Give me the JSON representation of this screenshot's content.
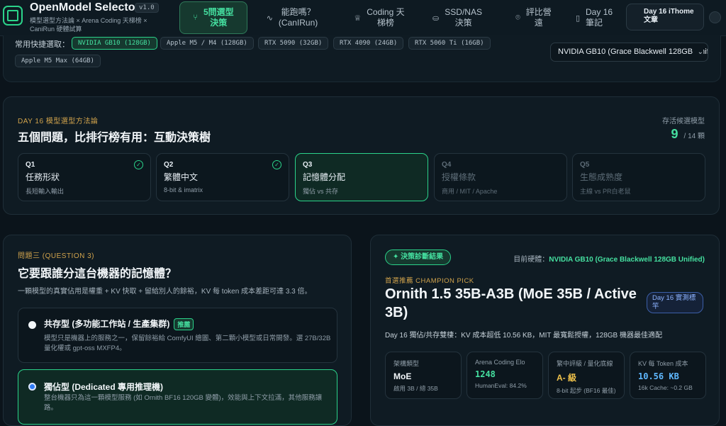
{
  "app": {
    "title": "OpenModel Selector",
    "version": "v1.0",
    "subtitle": "模型選型方法論 × Arena Coding 天梯榜 × CaniRun 硬體試算"
  },
  "nav": [
    {
      "label": "5問選型\n決策",
      "icon": "branch-icon",
      "active": true
    },
    {
      "label": "能跑嗎？\n(CanIRun)",
      "icon": "pulse-icon",
      "active": false
    },
    {
      "label": "Coding 天\n梯榜",
      "icon": "trophy-icon",
      "active": false
    },
    {
      "label": "SSD/NAS\n決策",
      "icon": "drive-icon",
      "active": false
    },
    {
      "label": "評比營\n遠",
      "icon": "satellite-icon",
      "active": false
    },
    {
      "label": "Day 16\n筆記",
      "icon": "book-icon",
      "active": false
    }
  ],
  "ithome": {
    "label": "Day 16 iThome\n文章"
  },
  "hardware": {
    "quick_label": "常用快捷選取：",
    "presets": [
      "NVIDIA GB10 (128GB)",
      "Apple M5 / M4 (128GB)",
      "RTX 5090 (32GB)",
      "RTX 4090 (24GB)",
      "RTX 5060 Ti (16GB)",
      "Apple M5 Max (64GB)"
    ],
    "selected_preset": "NVIDIA GB10 (128GB)",
    "select_value": "NVIDIA GB10 (Grace Blackwell 128GB Unif"
  },
  "tree": {
    "eyebrow": "DAY 16 模型選型方法論",
    "title": "五個問題，比排行榜有用：互動決策樹",
    "remaining_label": "存活候選模型",
    "remaining": "9",
    "total": "/ 14 顆",
    "questions": [
      {
        "num": "Q1",
        "title": "任務形狀",
        "sub": "長短輸入輸出",
        "state": "done"
      },
      {
        "num": "Q2",
        "title": "繁體中文",
        "sub": "8-bit & imatrix",
        "state": "done"
      },
      {
        "num": "Q3",
        "title": "記憶體分配",
        "sub": "獨佔 vs 共存",
        "state": "active"
      },
      {
        "num": "Q4",
        "title": "授權條款",
        "sub": "商用 / MIT / Apache",
        "state": "pending"
      },
      {
        "num": "Q5",
        "title": "生態成熟度",
        "sub": "主線 vs PR白老鼠",
        "state": "pending"
      }
    ]
  },
  "question": {
    "eyebrow": "問題三 (QUESTION 3)",
    "title": "它要跟誰分這台機器的記憶體？",
    "desc": "一顆模型的真實佔用是權重 + KV 快取 + 留給別人的餘裕，KV 每 token 成本差距可達 3.3 倍。",
    "options": [
      {
        "title": "共存型 (多功能工作站 / 生產集群)",
        "tag": "推薦",
        "desc": "模型只是機器上的服務之一，保留餘裕給 ComfyUI 繪圖、第二顆小模型或日常開發。選 27B/32B 量化權或 gpt-oss MXFP4。",
        "selected": false
      },
      {
        "title": "獨佔型 (Dedicated 專用推理機)",
        "tag": "",
        "desc": "整台機器只為這一顆模型服務 (如 Ornith BF16 120GB 變體)，效能與上下文拉滿，其他服務讓路。",
        "selected": true
      }
    ]
  },
  "result": {
    "badge": "決策診斷結果",
    "current_label": "目前硬體：",
    "current_value": "NVIDIA GB10 (Grace Blackwell 128GB Unified)",
    "champion_label": "首選推薦 CHAMPION PICK",
    "model_name": "Ornith 1.5 35B-A3B (MoE 35B / Active 3B)",
    "day_tag": "Day 16 實測標竿",
    "summary": "Day 16 獨佔/共存雙棲：KV 成本超低 10.56 KB，MIT 最寬鬆授權，128GB 機器最佳適配",
    "stats": [
      {
        "label": "架構類型",
        "value": "MoE",
        "sub": "啟用 3B / 總 35B",
        "color": "#f2f6f9"
      },
      {
        "label": "Arena Coding Elo",
        "value": "1248",
        "sub": "HumanEval: 84.2%",
        "color": "#45e0a0"
      },
      {
        "label": "繁中評級 / 量化底線",
        "value": "A- 級",
        "sub": "8-bit 起步 (BF16 最佳)",
        "color": "#f0c24b"
      },
      {
        "label": "KV 每 Token 成本",
        "value": "10.56 KB",
        "sub": "16k Cache: ~0.2 GB",
        "color": "#5fb8ff"
      }
    ]
  }
}
